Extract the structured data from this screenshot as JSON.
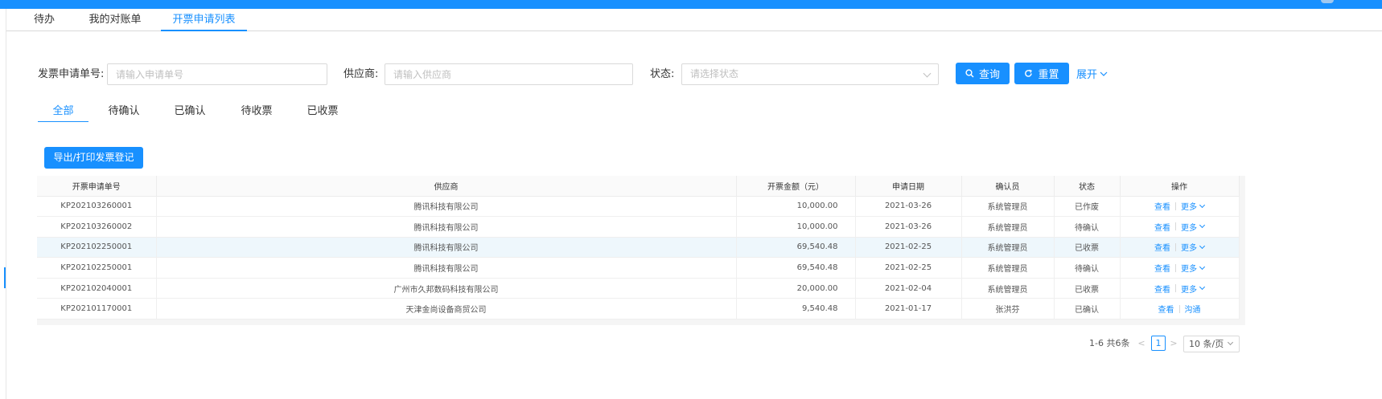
{
  "top_tabs": [
    "待办",
    "我的对账单",
    "开票申请列表"
  ],
  "filters": {
    "invoice_no_label": "发票申请单号:",
    "invoice_no_placeholder": "请输入申请单号",
    "supplier_label": "供应商:",
    "supplier_placeholder": "请输入供应商",
    "status_label": "状态:",
    "status_placeholder": "请选择状态",
    "query_button": "查询",
    "reset_button": "重置",
    "expand_label": "展开"
  },
  "status_tabs": [
    "全部",
    "待确认",
    "已确认",
    "待收票",
    "已收票"
  ],
  "export_button": "导出/打印发票登记",
  "table": {
    "columns": [
      "开票申请单号",
      "供应商",
      "开票金额（元）",
      "申请日期",
      "确认员",
      "状态",
      "操作"
    ],
    "rows": [
      {
        "id": "KP202103260001",
        "supplier": "腾讯科技有限公司",
        "amount": "10,000.00",
        "date": "2021-03-26",
        "confirmer": "系统管理员",
        "status": "已作废",
        "action1": "查看",
        "action2": "更多"
      },
      {
        "id": "KP202103260002",
        "supplier": "腾讯科技有限公司",
        "amount": "10,000.00",
        "date": "2021-03-26",
        "confirmer": "系统管理员",
        "status": "待确认",
        "action1": "查看",
        "action2": "更多"
      },
      {
        "id": "KP202102250001",
        "supplier": "腾讯科技有限公司",
        "amount": "69,540.48",
        "date": "2021-02-25",
        "confirmer": "系统管理员",
        "status": "已收票",
        "action1": "查看",
        "action2": "更多"
      },
      {
        "id": "KP202102250001",
        "supplier": "腾讯科技有限公司",
        "amount": "69,540.48",
        "date": "2021-02-25",
        "confirmer": "系统管理员",
        "status": "待确认",
        "action1": "查看",
        "action2": "更多"
      },
      {
        "id": "KP202102040001",
        "supplier": "广州市久邦数码科技有限公司",
        "amount": "20,000.00",
        "date": "2021-02-04",
        "confirmer": "系统管理员",
        "status": "已收票",
        "action1": "查看",
        "action2": "更多"
      },
      {
        "id": "KP202101170001",
        "supplier": "天津金尚设备商贸公司",
        "amount": "9,540.48",
        "date": "2021-01-17",
        "confirmer": "张洪芬",
        "status": "已确认",
        "action1": "查看",
        "action2": "沟通"
      }
    ]
  },
  "pagination": {
    "total_text": "1-6 共6条",
    "prev": "<",
    "current_page": "1",
    "next": ">",
    "page_size": "10 条/页"
  },
  "colors": {
    "primary": "#1890ff",
    "highlight_row": "#eef7fc"
  }
}
